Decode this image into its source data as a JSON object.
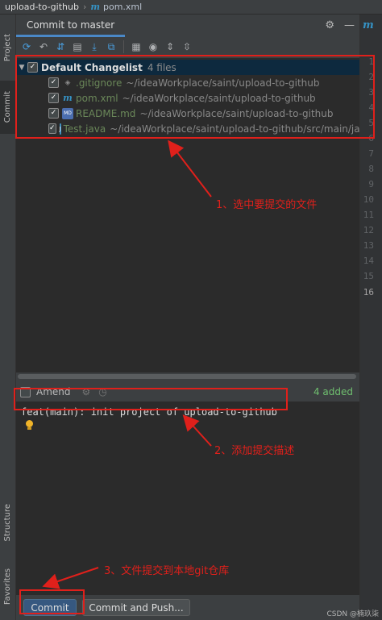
{
  "titlebar": {
    "project": "upload-to-github",
    "file": "pom.xml"
  },
  "leftbar": {
    "tabs": [
      {
        "label": "Project"
      },
      {
        "label": "Commit"
      },
      {
        "label": "Structure"
      },
      {
        "label": "Favorites"
      }
    ]
  },
  "panel": {
    "tab_label": "Commit to master",
    "changelist": {
      "name": "Default Changelist",
      "count": "4 files",
      "files": [
        {
          "name": ".gitignore",
          "path": "~/ideaWorkplace/saint/upload-to-github",
          "icon": "gitignore-file-icon",
          "status": "new"
        },
        {
          "name": "pom.xml",
          "path": "~/ideaWorkplace/saint/upload-to-github",
          "icon": "maven-file-icon",
          "status": "new"
        },
        {
          "name": "README.md",
          "path": "~/ideaWorkplace/saint/upload-to-github",
          "icon": "markdown-file-icon",
          "status": "new"
        },
        {
          "name": "Test.java",
          "path": "~/ideaWorkplace/saint/upload-to-github/src/main/jav",
          "icon": "java-file-icon",
          "status": "new"
        }
      ]
    },
    "amend": {
      "label": "Amend",
      "added": "4 added"
    },
    "commit_message": "feat(main): init project of upload-to-github",
    "buttons": {
      "commit": "Commit",
      "commit_push": "Commit and Push..."
    }
  },
  "editor": {
    "line_numbers": [
      "1",
      "2",
      "3",
      "4",
      "5",
      "6",
      "7",
      "8",
      "9",
      "10",
      "11",
      "12",
      "13",
      "14",
      "15",
      "16"
    ],
    "current_line": "16"
  },
  "annotations": {
    "step1": "1、选中要提交的文件",
    "step2": "2、添加提交描述",
    "step3": "3、文件提交到本地git仓库"
  },
  "watermark": "CSDN @楠玖柒",
  "colors": {
    "accent": "#4a88c7",
    "annotation": "#e0201b",
    "added": "#6fbf6f",
    "primary_button": "#365880"
  }
}
